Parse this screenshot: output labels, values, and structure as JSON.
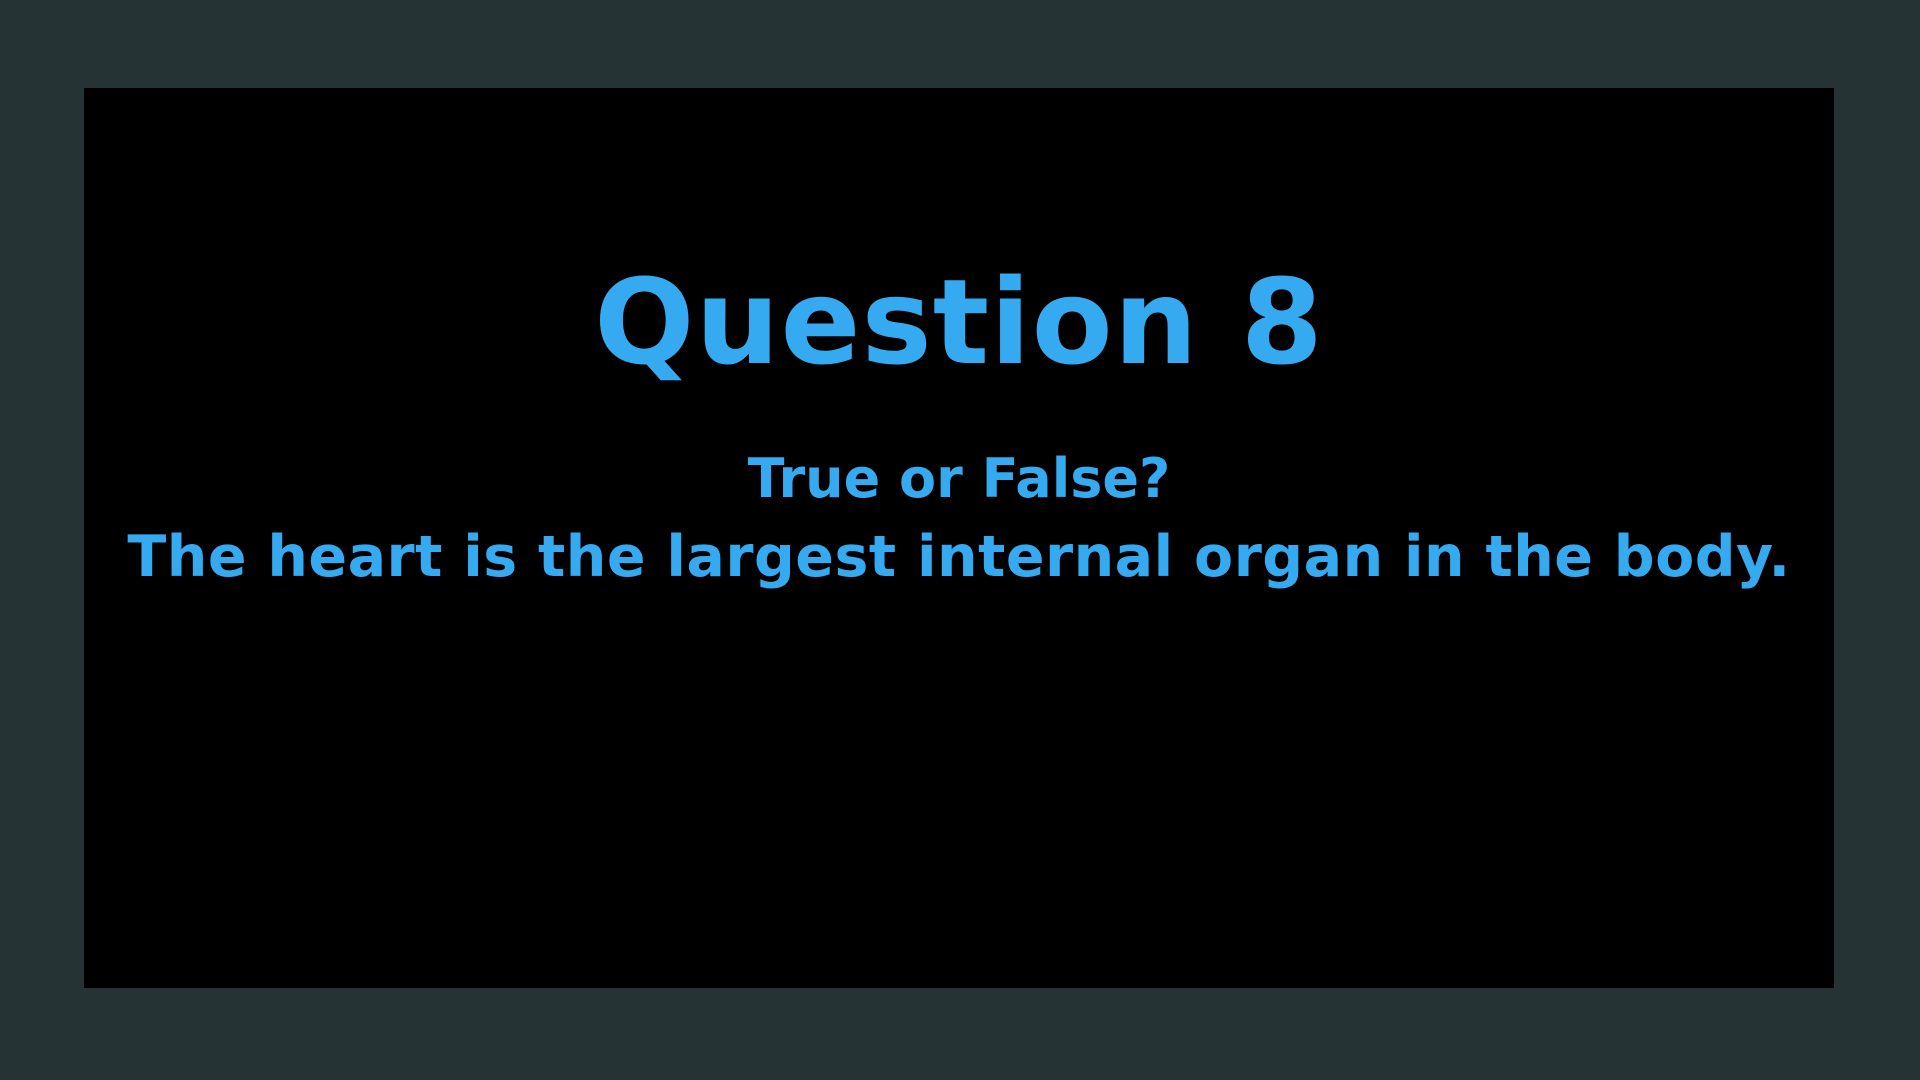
{
  "slide": {
    "title": "Question 8",
    "lines": [
      "True or False?",
      "The heart is the largest internal organ in the body."
    ]
  },
  "colors": {
    "frame_background": "#253335",
    "slide_background": "#000000",
    "text": "#35aaf0"
  }
}
